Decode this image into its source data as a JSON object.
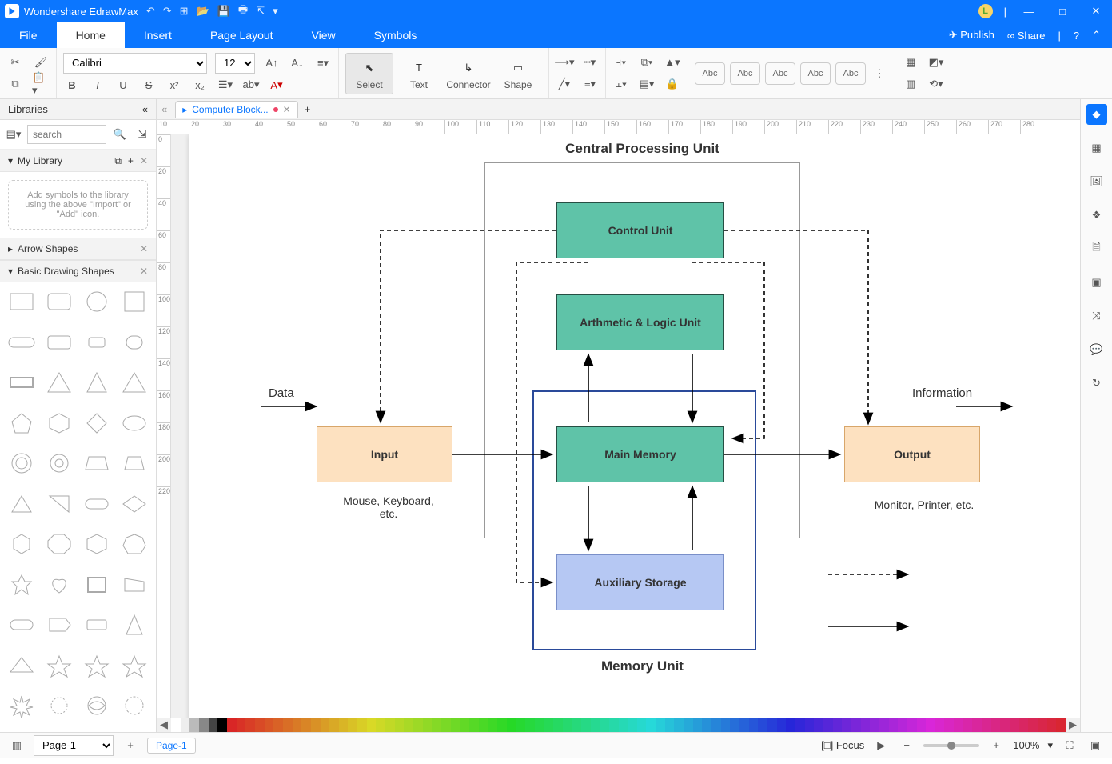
{
  "app_name": "Wondershare EdrawMax",
  "window_buttons": {
    "min": "—",
    "max": "□",
    "close": "✕"
  },
  "menubar": {
    "tabs": [
      "File",
      "Home",
      "Insert",
      "Page Layout",
      "View",
      "Symbols"
    ],
    "active": "Home",
    "publish": "Publish",
    "share": "Share"
  },
  "ribbon": {
    "font_name": "Calibri",
    "font_size": "12",
    "tools": {
      "select": "Select",
      "text": "Text",
      "connector": "Connector",
      "shape": "Shape"
    },
    "abc": "Abc",
    "more": "⋮"
  },
  "doc_tab": {
    "name": "Computer Block..."
  },
  "libraries": {
    "title": "Libraries",
    "search_ph": "search",
    "mylib": "My Library",
    "hint": "Add symbols to the library using the above \"Import\" or \"Add\" icon.",
    "cats": [
      "Arrow Shapes",
      "Basic Drawing Shapes"
    ]
  },
  "diagram": {
    "title": "Central Processing Unit",
    "control": "Control Unit",
    "alu": "Arthmetic & Logic Unit",
    "mem": "Main Memory",
    "aux": "Auxiliary Storage",
    "input": "Input",
    "output": "Output",
    "data": "Data",
    "info": "Information",
    "memunit": "Memory Unit",
    "input_sub": "Mouse, Keyboard, etc.",
    "output_sub": "Monitor, Printer, etc."
  },
  "status": {
    "page_combo": "Page-1",
    "page_tab": "Page-1",
    "focus": "Focus",
    "zoom": "100%"
  },
  "colors": [
    "#000",
    "#404040",
    "#7f7f7f",
    "#bfbfbf",
    "#fff",
    "#800000",
    "#c00",
    "#f00",
    "#ff8080",
    "#ff0080",
    "#ff00ff",
    "#c000c0",
    "#800080",
    "#400080",
    "#8000ff",
    "#0000ff",
    "#0080ff",
    "#00c0ff",
    "#00ffff",
    "#00ffc0",
    "#00ff80",
    "#00ff00",
    "#80ff00",
    "#c0ff00",
    "#ffff00",
    "#ffc000",
    "#ff8000",
    "#ff4000",
    "#804000",
    "#c08040",
    "#008000",
    "#004080",
    "#808000",
    "#408080",
    "#800040"
  ]
}
